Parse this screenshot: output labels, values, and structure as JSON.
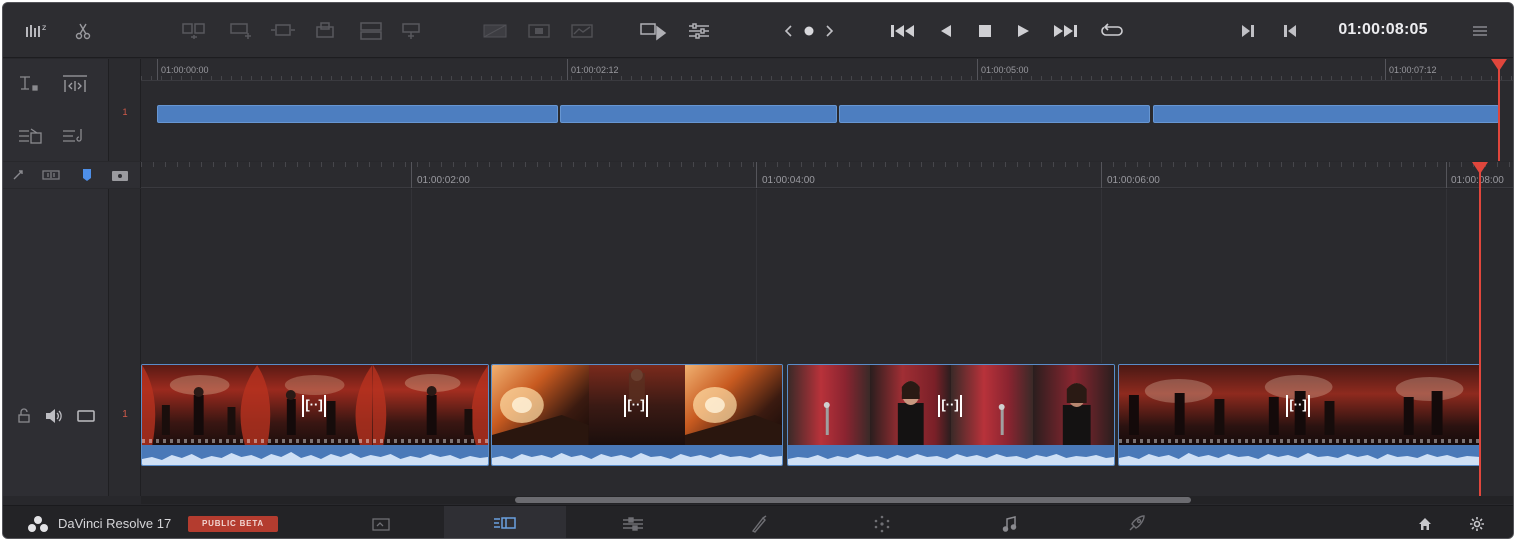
{
  "toolbar": {
    "timecode": "01:00:08:05",
    "icons": [
      "metronome-icon",
      "scissors-icon",
      "smart-insert-icon",
      "append-icon",
      "ripple-overwrite-icon",
      "close-up-icon",
      "place-on-top-icon",
      "source-overwrite-icon",
      "transition-dissolve-icon",
      "transition-smooth-icon",
      "transition-wipe-icon",
      "source-tape-icon",
      "clip-attributes-icon",
      "prev-arrow-icon",
      "dot-icon",
      "next-arrow-icon",
      "skip-to-start-icon",
      "play-reverse-icon",
      "stop-icon",
      "play-icon",
      "skip-to-end-icon",
      "loop-icon",
      "mark-in-icon",
      "mark-out-icon",
      "menu-icon"
    ]
  },
  "upper_timeline": {
    "track_number": "1",
    "ruler_labels": [
      "01:00:00:00",
      "01:00:02:12",
      "01:00:05:00",
      "01:00:07:12"
    ]
  },
  "lower_timeline": {
    "track_number": "1",
    "ruler_labels": [
      "01:00:02:00",
      "01:00:04:00",
      "01:00:06:00",
      "01:00:08:00"
    ],
    "clip_marker": "[··]"
  },
  "bottombar": {
    "app_name": "DaVinci Resolve 17",
    "beta_label": "PUBLIC BETA",
    "pages": [
      "media-page-icon",
      "cut-page-icon",
      "edit-page-icon",
      "fusion-page-icon",
      "color-page-icon",
      "fairlight-page-icon",
      "deliver-page-icon"
    ],
    "active_page": "cut-page-icon"
  },
  "colors": {
    "accent": "#4d7ec0",
    "playhead": "#e0463c",
    "beta_badge": "#b43c2f"
  }
}
